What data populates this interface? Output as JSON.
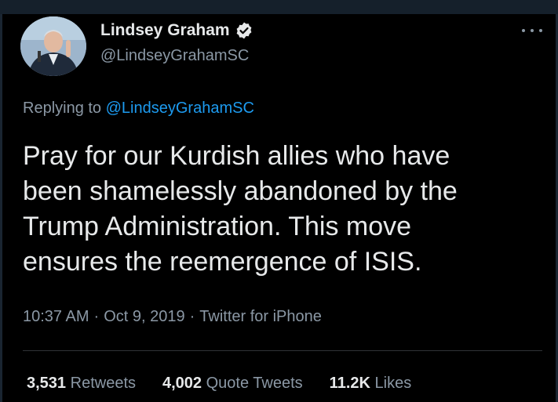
{
  "author": {
    "display_name": "Lindsey Graham",
    "handle": "@LindseyGrahamSC",
    "verified_icon": "verified-badge-icon"
  },
  "reply": {
    "prefix": "Replying to ",
    "mention": "@LindseyGrahamSC"
  },
  "tweet": {
    "text": "Pray for our Kurdish allies who have\nbeen shamelessly abandoned by the\nTrump Administration.  This move\nensures the reemergence of ISIS.",
    "time": "10:37 AM",
    "date": "Oct 9, 2019",
    "source": "Twitter for iPhone",
    "separator": "·"
  },
  "stats": {
    "retweets_count": "3,531",
    "retweets_label": "Retweets",
    "quotes_count": "4,002",
    "quotes_label": "Quote Tweets",
    "likes_count": "11.2K",
    "likes_label": "Likes"
  },
  "colors": {
    "background": "#000000",
    "text": "#e7e9ea",
    "secondary": "#8b98a5",
    "accent": "#1d9bf0"
  }
}
